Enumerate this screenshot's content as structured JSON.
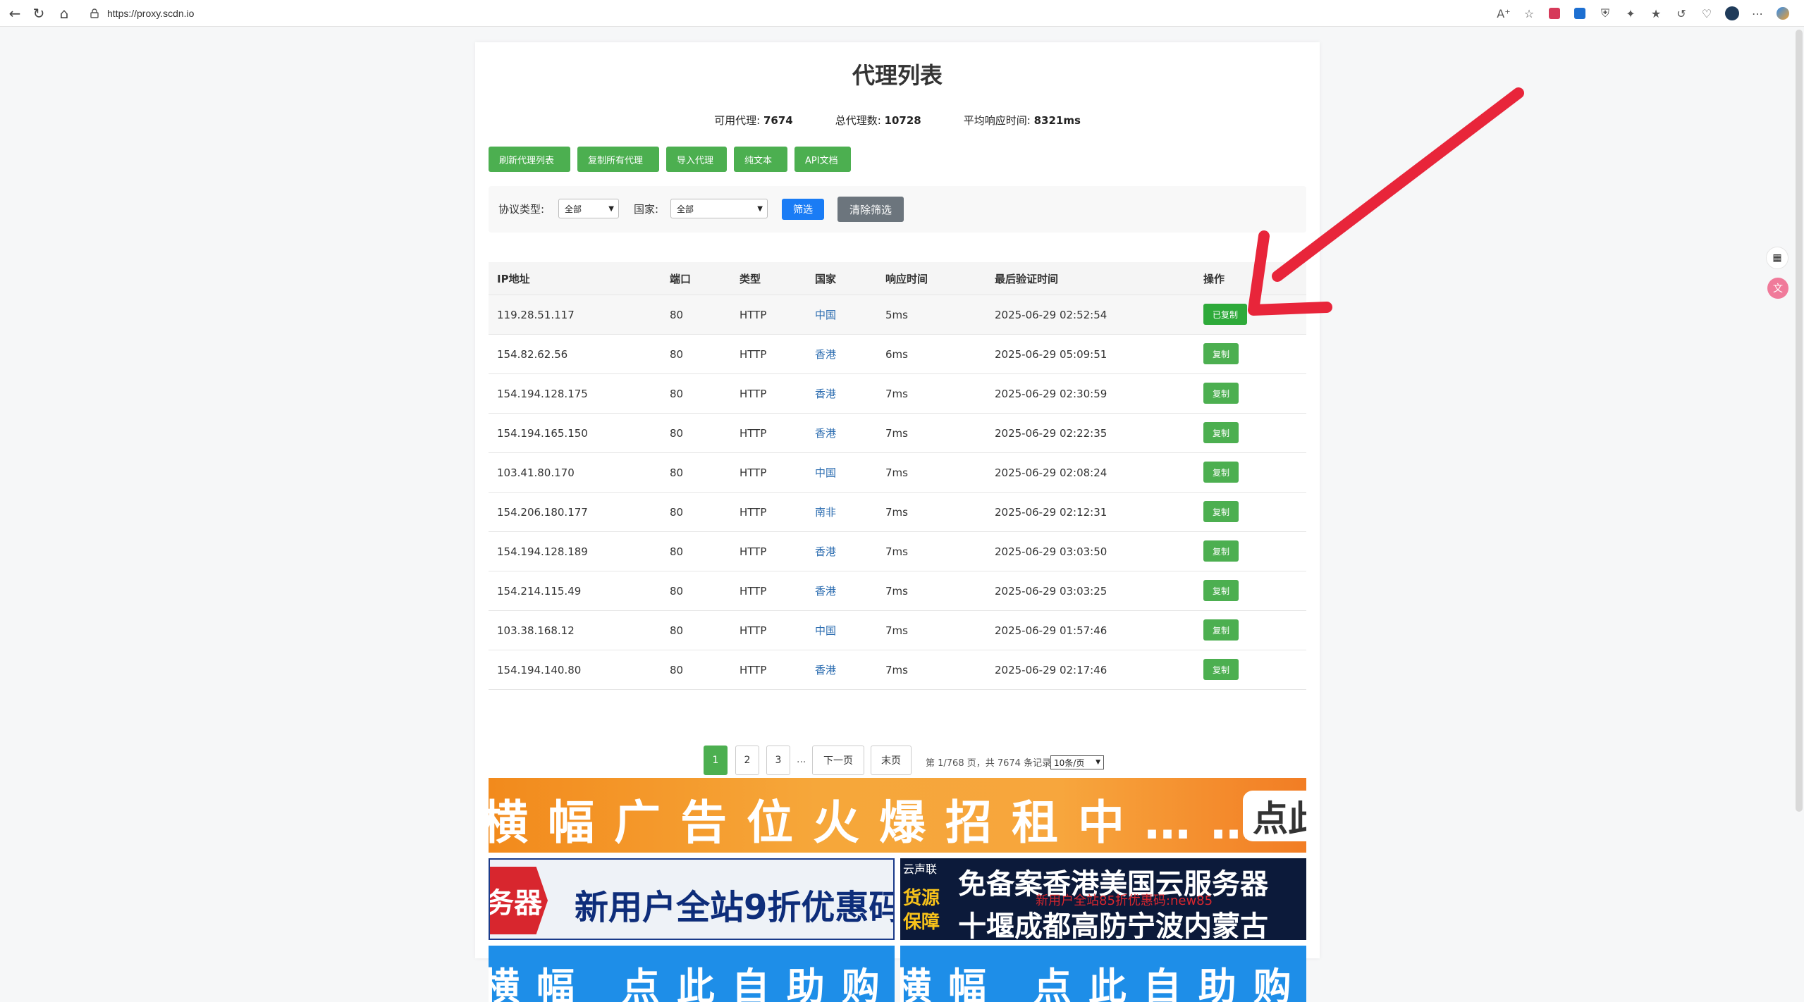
{
  "browser": {
    "url": "https://proxy.scdn.io"
  },
  "page": {
    "title": "代理列表",
    "stats": {
      "available_label": "可用代理:",
      "available_value": "7674",
      "total_label": "总代理数:",
      "total_value": "10728",
      "avg_label": "平均响应时间:",
      "avg_value": "8321ms"
    },
    "actions": [
      "刷新代理列表",
      "复制所有代理",
      "导入代理",
      "纯文本",
      "API文档"
    ],
    "filter": {
      "protocol_label": "协议类型:",
      "protocol_value": "全部",
      "country_label": "国家:",
      "country_value": "全部",
      "filter_button": "筛选",
      "clear_button": "清除筛选"
    },
    "table": {
      "headers": [
        "IP地址",
        "端口",
        "类型",
        "国家",
        "响应时间",
        "最后验证时间",
        "操作"
      ],
      "rows": [
        {
          "ip": "119.28.51.117",
          "port": "80",
          "type": "HTTP",
          "country": "中国",
          "time": "5ms",
          "verified": "2025-06-29 02:52:54",
          "action": "已复制"
        },
        {
          "ip": "154.82.62.56",
          "port": "80",
          "type": "HTTP",
          "country": "香港",
          "time": "6ms",
          "verified": "2025-06-29 05:09:51",
          "action": "复制"
        },
        {
          "ip": "154.194.128.175",
          "port": "80",
          "type": "HTTP",
          "country": "香港",
          "time": "7ms",
          "verified": "2025-06-29 02:30:59",
          "action": "复制"
        },
        {
          "ip": "154.194.165.150",
          "port": "80",
          "type": "HTTP",
          "country": "香港",
          "time": "7ms",
          "verified": "2025-06-29 02:22:35",
          "action": "复制"
        },
        {
          "ip": "103.41.80.170",
          "port": "80",
          "type": "HTTP",
          "country": "中国",
          "time": "7ms",
          "verified": "2025-06-29 02:08:24",
          "action": "复制"
        },
        {
          "ip": "154.206.180.177",
          "port": "80",
          "type": "HTTP",
          "country": "南非",
          "time": "7ms",
          "verified": "2025-06-29 02:12:31",
          "action": "复制"
        },
        {
          "ip": "154.194.128.189",
          "port": "80",
          "type": "HTTP",
          "country": "香港",
          "time": "7ms",
          "verified": "2025-06-29 03:03:50",
          "action": "复制"
        },
        {
          "ip": "154.214.115.49",
          "port": "80",
          "type": "HTTP",
          "country": "香港",
          "time": "7ms",
          "verified": "2025-06-29 03:03:25",
          "action": "复制"
        },
        {
          "ip": "103.38.168.12",
          "port": "80",
          "type": "HTTP",
          "country": "中国",
          "time": "7ms",
          "verified": "2025-06-29 01:57:46",
          "action": "复制"
        },
        {
          "ip": "154.194.140.80",
          "port": "80",
          "type": "HTTP",
          "country": "香港",
          "time": "7ms",
          "verified": "2025-06-29 02:17:46",
          "action": "复制"
        }
      ]
    },
    "pagination": {
      "pages": [
        "1",
        "2",
        "3"
      ],
      "ellipsis": "...",
      "next": "下一页",
      "last": "末页",
      "info": "第 1/768 页，共 7674 条记录",
      "page_size": "10条/页"
    },
    "ads": {
      "banner1": "横幅广告位火爆招租中……",
      "banner1_click": "点此",
      "banner2_left_tag": "务器",
      "banner2_text": "新用户全站9折优惠码",
      "banner3_tag": "云声联",
      "banner3_side": "货源保障",
      "banner3_line1": "免备案香港美国云服务器",
      "banner3_line2": "新用户全站85折优惠码:new85",
      "banner3_line3": "十堰成都高防宁波内蒙古",
      "banner4": "横幅 点此自助购",
      "banner5": "横幅 点此自助购"
    }
  },
  "colors": {
    "green": "#4caf50",
    "blue": "#1a7cf5",
    "gray": "#6c757d",
    "arrow": "#e8253a"
  }
}
